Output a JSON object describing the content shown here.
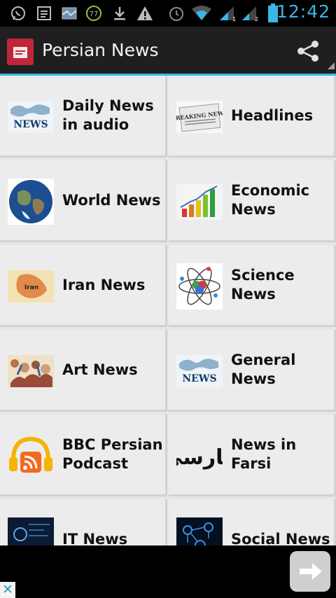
{
  "status_bar": {
    "time": "12:42",
    "notification_count": "77",
    "icons": [
      "whatsapp-icon",
      "messages-icon",
      "map-icon",
      "badge-count-icon",
      "download-icon",
      "warning-icon",
      "alarm-icon",
      "wifi-icon",
      "signal-1-icon",
      "signal-2-icon",
      "battery-icon"
    ]
  },
  "app_bar": {
    "title": "Persian News",
    "logo_text": "PERSIAN News",
    "share_icon": "share-icon"
  },
  "tiles": [
    {
      "label": "Daily News in audio",
      "icon": "news-world-map-thumb",
      "thumb_text": "NEWS"
    },
    {
      "label": "Headlines",
      "icon": "newspaper-headlines-thumb",
      "thumb_text": "BREAKING NEWS"
    },
    {
      "label": "World News",
      "icon": "earth-globe-thumb"
    },
    {
      "label": "Economic News",
      "icon": "bar-chart-growth-thumb"
    },
    {
      "label": "Iran News",
      "icon": "iran-map-thumb",
      "thumb_text": "Iran"
    },
    {
      "label": "Science News",
      "icon": "atom-molecule-thumb"
    },
    {
      "label": "Art News",
      "icon": "art-crowd-thumb"
    },
    {
      "label": "General News",
      "icon": "news-world-map-thumb",
      "thumb_text": "NEWS"
    },
    {
      "label": "BBC Persian Podcast",
      "icon": "podcast-headphones-thumb"
    },
    {
      "label": "News in Farsi",
      "icon": "farsi-calligraphy-thumb",
      "thumb_text": "فارسی"
    },
    {
      "label": "IT News",
      "icon": "it-circuit-thumb"
    },
    {
      "label": "Social News",
      "icon": "social-network-thumb"
    }
  ],
  "ad_bar": {
    "close_label": "✕",
    "next_icon": "arrow-right-icon"
  },
  "colors": {
    "accent": "#33b5e5",
    "action_bar": "#1f1f1f",
    "tile_bg": "#ececec",
    "logo_red": "#c0263a"
  }
}
